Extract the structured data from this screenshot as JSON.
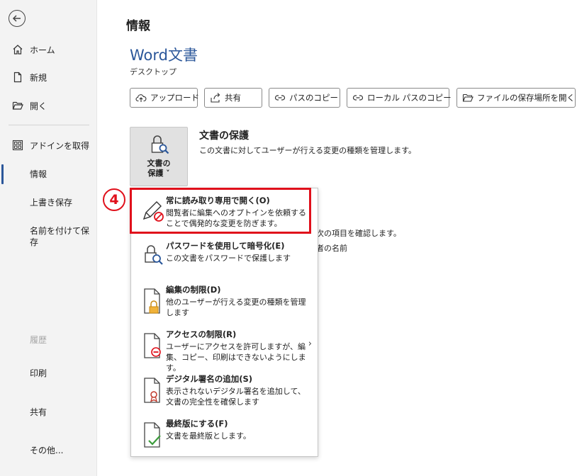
{
  "sidebar": {
    "back_label": "←",
    "items": [
      {
        "label": "ホーム"
      },
      {
        "label": "新規"
      },
      {
        "label": "開く"
      },
      {
        "label": "アドインを取得"
      },
      {
        "label": "情報"
      },
      {
        "label": "上書き保存"
      },
      {
        "label": "名前を付けて保存"
      },
      {
        "label": "履歴"
      },
      {
        "label": "印刷"
      },
      {
        "label": "共有"
      },
      {
        "label": "その他..."
      }
    ]
  },
  "main": {
    "title": "情報",
    "doc_title": "Word文書",
    "doc_path": "デスクトップ",
    "toolbar": [
      {
        "label": "アップロード"
      },
      {
        "label": "共有"
      },
      {
        "label": "パスのコピー"
      },
      {
        "label": "ローカル パスのコピー"
      },
      {
        "label": "ファイルの保存場所を開く"
      }
    ],
    "protect_button": {
      "line1": "文書の",
      "line2": "保護 ˅"
    },
    "section_title": "文書の保護",
    "section_desc": "この文書に対してユーザーが行える変更の種類を管理します。",
    "background_text_1": "次の項目を確認します。",
    "background_text_2": "者の名前"
  },
  "menu": {
    "items": [
      {
        "title": "常に読み取り専用で開く(O)",
        "desc": "閲覧者に編集へのオプトインを依頼することで偶発的な変更を防ぎます。"
      },
      {
        "title": "パスワードを使用して暗号化(E)",
        "desc": "この文書をパスワードで保護します"
      },
      {
        "title": "編集の制限(D)",
        "desc": "他のユーザーが行える変更の種類を管理します"
      },
      {
        "title": "アクセスの制限(R)",
        "desc": "ユーザーにアクセスを許可しますが、編集、コピー、印刷はできないようにします。"
      },
      {
        "title": "デジタル署名の追加(S)",
        "desc": "表示されないデジタル署名を追加して、文書の完全性を確保します"
      },
      {
        "title": "最終版にする(F)",
        "desc": "文書を最終版とします。"
      }
    ],
    "submenu_arrow": "›"
  },
  "annotation": {
    "step": "4"
  },
  "colors": {
    "accent": "#2b579a",
    "highlight": "#e0101b"
  }
}
